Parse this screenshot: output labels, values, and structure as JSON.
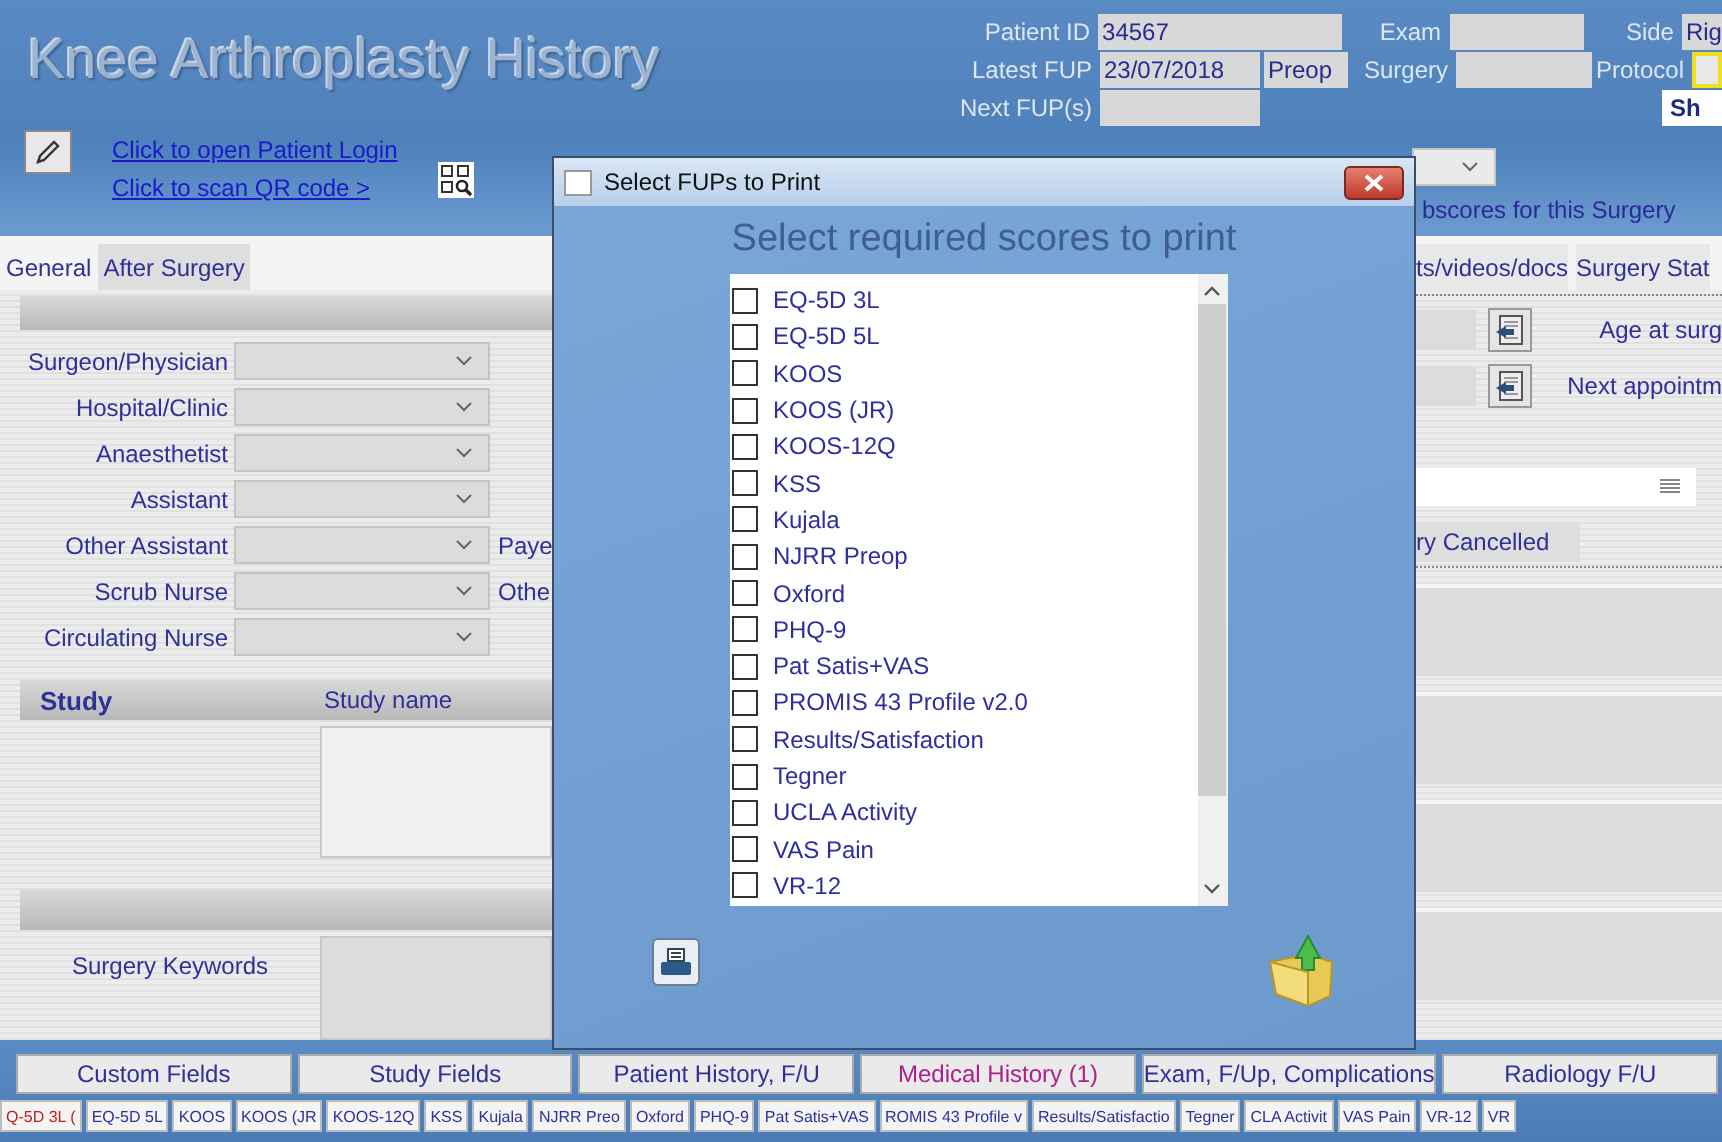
{
  "header": {
    "title": "Knee Arthroplasty History",
    "patient_login_link": "Click to open Patient Login",
    "qr_link": "Click to scan QR code >"
  },
  "patient": {
    "patient_id_label": "Patient ID",
    "patient_id": "34567",
    "exam_label": "Exam",
    "side_label": "Side",
    "side": "Rig",
    "latest_fup_label": "Latest FUP",
    "latest_fup": "23/07/2018",
    "latest_fup_stage": "Preop",
    "surgery_label": "Surgery",
    "protocol_label": "Protocol",
    "next_fup_label": "Next FUP(s)",
    "show_button": "Sh"
  },
  "subscores_link": "bscores for this Surgery",
  "tabs": [
    {
      "label": "General",
      "selected": true
    },
    {
      "label": "After Surgery",
      "selected": false
    }
  ],
  "right_tabs": [
    "ts/videos/docs",
    "Surgery Stat"
  ],
  "form_rows": [
    {
      "label": "Surgeon/Physician"
    },
    {
      "label": "Hospital/Clinic"
    },
    {
      "label": "Anaesthetist"
    },
    {
      "label": "Assistant"
    },
    {
      "label": "Other Assistant",
      "side_label": "Paye"
    },
    {
      "label": "Scrub Nurse",
      "side_label": "Othe"
    },
    {
      "label": "Circulating Nurse"
    }
  ],
  "study": {
    "column_1": "Study",
    "column_2": "Study name"
  },
  "keywords_label": "Surgery Keywords",
  "right_panel": {
    "age_label": "Age at surg",
    "next_appointment_label": "Next appointm",
    "cancelled_label": "ry Cancelled"
  },
  "dialog": {
    "title": "Select FUPs to Print",
    "heading": "Select required scores to print",
    "items": [
      {
        "label": "EQ-5D 3L",
        "checked": false
      },
      {
        "label": "EQ-5D 5L",
        "checked": false
      },
      {
        "label": "KOOS",
        "checked": false
      },
      {
        "label": "KOOS (JR)",
        "checked": false
      },
      {
        "label": "KOOS-12Q",
        "checked": false
      },
      {
        "label": "KSS",
        "checked": false
      },
      {
        "label": "Kujala",
        "checked": false
      },
      {
        "label": "NJRR Preop",
        "checked": false
      },
      {
        "label": "Oxford",
        "checked": false
      },
      {
        "label": "PHQ-9",
        "checked": false
      },
      {
        "label": "Pat Satis+VAS",
        "checked": false
      },
      {
        "label": "PROMIS 43 Profile v2.0",
        "checked": false
      },
      {
        "label": "Results/Satisfaction",
        "checked": false
      },
      {
        "label": "Tegner",
        "checked": false
      },
      {
        "label": "UCLA Activity",
        "checked": false
      },
      {
        "label": "VAS Pain",
        "checked": false
      },
      {
        "label": "VR-12",
        "checked": false
      }
    ]
  },
  "bottom_tabs": [
    {
      "label": "Custom Fields",
      "selected": false
    },
    {
      "label": "Study Fields",
      "selected": false
    },
    {
      "label": "Patient History, F/U",
      "selected": false
    },
    {
      "label": "Medical History (1)",
      "selected": true
    },
    {
      "label": "Exam, F/Up, Complications",
      "selected": false
    },
    {
      "label": "Radiology F/U",
      "selected": false
    }
  ],
  "score_tabs": [
    {
      "label": "Q-5D 3L (",
      "selected": true
    },
    {
      "label": "EQ-5D 5L",
      "selected": false
    },
    {
      "label": "KOOS",
      "selected": false
    },
    {
      "label": "KOOS (JR",
      "selected": false
    },
    {
      "label": "KOOS-12Q",
      "selected": false
    },
    {
      "label": "KSS",
      "selected": false
    },
    {
      "label": "Kujala",
      "selected": false
    },
    {
      "label": "NJRR Preo",
      "selected": false
    },
    {
      "label": "Oxford",
      "selected": false
    },
    {
      "label": "PHQ-9",
      "selected": false
    },
    {
      "label": "Pat Satis+VAS",
      "selected": false
    },
    {
      "label": "ROMIS 43 Profile v",
      "selected": false
    },
    {
      "label": "Results/Satisfactio",
      "selected": false
    },
    {
      "label": "Tegner",
      "selected": false
    },
    {
      "label": "CLA Activit",
      "selected": false
    },
    {
      "label": "VAS Pain",
      "selected": false
    },
    {
      "label": "VR-12",
      "selected": false
    },
    {
      "label": "VR",
      "selected": false
    }
  ]
}
